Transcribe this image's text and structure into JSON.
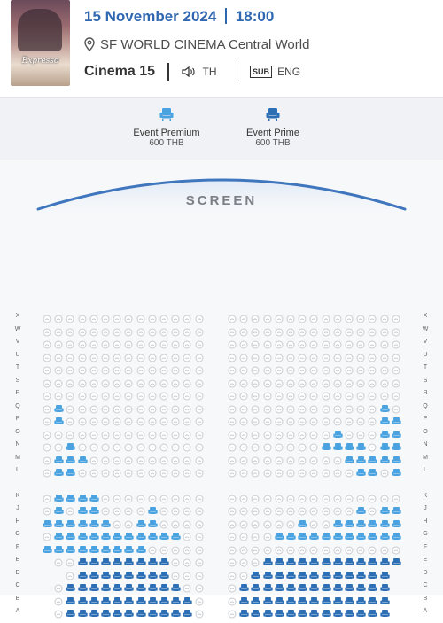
{
  "header": {
    "poster": {
      "title": "Expresso"
    },
    "date": "15 November 2024",
    "time": "18:00",
    "location": "SF WORLD CINEMA Central World",
    "cinema": "Cinema 15",
    "audio": "TH",
    "subtitle_badge": "SUB",
    "subtitle_lang": "ENG"
  },
  "legend": [
    {
      "name": "Event Premium",
      "price": "600 THB",
      "color": "#4aa3e0"
    },
    {
      "name": "Event Prime",
      "price": "600 THB",
      "color": "#2d6fb5"
    }
  ],
  "screen": {
    "label": "SCREEN"
  },
  "colors": {
    "available_seat": "#c9cbd0",
    "premium": "#4aa3e0",
    "prime": "#2d6fb5",
    "accent": "#2f67b1"
  },
  "seat_rows": [
    {
      "label": "X",
      "left": "aaaaaaaaaaaaaa",
      "right": "aaaaaaaaaaaaaaa"
    },
    {
      "label": "W",
      "left": "aaaaaaaaaaaaaa",
      "right": "aaaaaaaaaaaaaaa"
    },
    {
      "label": "V",
      "left": "aaaaaaaaaaaaaa",
      "right": "aaaaaaaaaaaaaaa"
    },
    {
      "label": "U",
      "left": "aaaaaaaaaaaaaa",
      "right": "aaaaaaaaaaaaaaa"
    },
    {
      "label": "T",
      "left": "aaaaaaaaaaaaaa",
      "right": "aaaaaaaaaaaaaaa"
    },
    {
      "label": "S",
      "left": "aaaaaaaaaaaaaa",
      "right": "aaaaaaaaaaaaaaa"
    },
    {
      "label": "R",
      "left": "aaaaaaaaaaaaaa",
      "right": "aaaaaaaaaaaaaaa"
    },
    {
      "label": "Q",
      "left": "aPaaaaaaaaaaaa",
      "right": "aaaaaaaaaaaaaPa"
    },
    {
      "label": "P",
      "left": "aPaaaaaaaaaaaa",
      "right": "aaaaaaaaaaaaaPP"
    },
    {
      "label": "O",
      "left": "aaaaaaaaaaaaaa",
      "right": "aaaaaaaaaPaaaPP"
    },
    {
      "label": "N",
      "left": "aaPaaaaaaaaaaa",
      "right": "aaaaaaaaPPPPaPP"
    },
    {
      "label": "M",
      "left": "aPPPaaaaaaaaaa",
      "right": "aaaaaaaaaaPPPPP"
    },
    {
      "label": "L",
      "left": "aPPaaaaaaaaaaa",
      "right": "aaaaaaaaaaaPPaP"
    },
    {
      "label": "K",
      "left": "aPPPPaaaaaaaaa",
      "right": "aaaaaaaaaaaaaaa"
    },
    {
      "label": "J",
      "left": "aPaPPaaaaPaaaa",
      "right": "aaaaaaaaaaaPaPP"
    },
    {
      "label": "H",
      "left": "PPPPPPaaPPaaaa",
      "right": "aaaaaaPaaPPPPPP"
    },
    {
      "label": "G",
      "left": "aPPPPPPPPPPPaa",
      "right": "aaaaPPPPPPPPPPP"
    },
    {
      "label": "F",
      "left": "PPPPPPPPPaaaaa",
      "right": "aaaaaaaaaaaaaaa"
    },
    {
      "label": "E",
      "left": "aaTTTTTTTTaaa",
      "right": "aaaTTTTTTTTTTTT"
    },
    {
      "label": "D",
      "left": "aTTTTTTTTaaa",
      "right": "aaTTTTTTTTTTTT"
    },
    {
      "label": "C",
      "left": "aTTTTTTTTTTaa",
      "right": "aTTTTTTTTTTTTT"
    },
    {
      "label": "B",
      "left": "aTTTTTTTTTTTa",
      "right": "aTTTTTTTTTTTTT"
    },
    {
      "label": "A",
      "left": "aTTTTTTTTTTTa",
      "right": "aTTTTTTTTTTTTT"
    }
  ]
}
